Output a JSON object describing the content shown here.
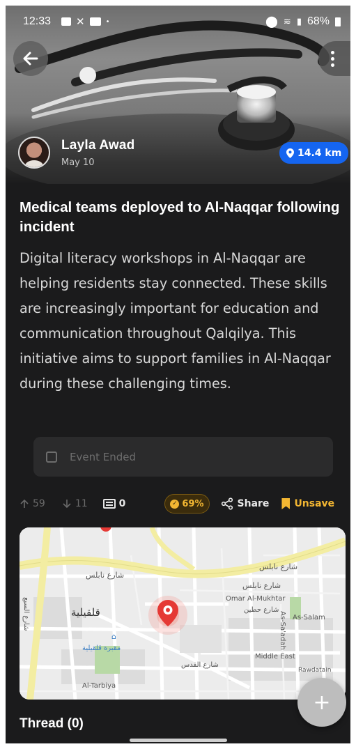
{
  "status_bar": {
    "time": "12:33",
    "battery": "68%"
  },
  "post": {
    "author_name": "Layla Awad",
    "date": "May 10",
    "distance": "14.4 km",
    "title": "Medical teams deployed to Al-Naqqar following incident",
    "body": "Digital literacy workshops in Al-Naqqar are helping residents stay connected. These skills are increasingly important for education and communication throughout Qalqilya. This initiative aims to support families in Al-Naqqar during these challenging times.",
    "event_status": "Event Ended"
  },
  "actions": {
    "upvotes": "59",
    "downvotes": "11",
    "comments": "0",
    "score": "69%",
    "share_label": "Share",
    "save_label": "Unsave"
  },
  "map": {
    "labels": {
      "nablus_st_1": "شارع نابلس",
      "nablus_st_2": "شارع نابلس",
      "nablus_st_3": "شارع نابلس",
      "city": "قلقيلية",
      "cemetery": "مقبرة قلقيلية",
      "omar": "Omar Al-Mukhtar",
      "hittin": "شارع حطين",
      "as_saadah": "As-Sa'adah",
      "as_salam": "As-Salam",
      "middle_east": "Middle East",
      "al_quds": "شارع القدس",
      "al_tarbiya": "Al-Tarbiya",
      "as_sisa": "شارع السبع",
      "rawdatain": "Rawdatain"
    }
  },
  "thread": {
    "label": "Thread (0)"
  },
  "colors": {
    "background": "#1b1b1c",
    "accent_blue": "#1565f0",
    "accent_gold": "#f2b632",
    "map_pin": "#e53935"
  }
}
